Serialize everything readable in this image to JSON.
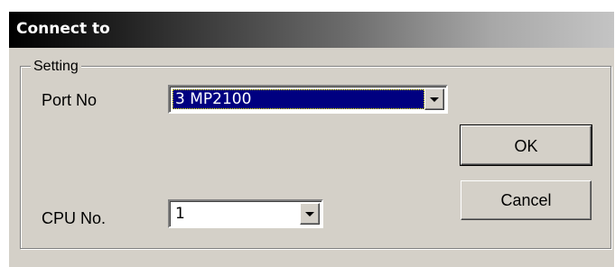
{
  "window": {
    "title": "Connect to"
  },
  "group": {
    "label": "Setting"
  },
  "port": {
    "label": "Port No",
    "selected_value": "3  MP2100"
  },
  "cpu": {
    "label": "CPU No.",
    "selected_value": "1"
  },
  "buttons": {
    "ok_label": "OK",
    "cancel_label": "Cancel"
  },
  "icons": {
    "dropdown": "chevron-down-icon"
  },
  "colors": {
    "face": "#d4d0c8",
    "selection": "#000080",
    "title_start": "#000000",
    "title_end": "#c4c4c4"
  }
}
